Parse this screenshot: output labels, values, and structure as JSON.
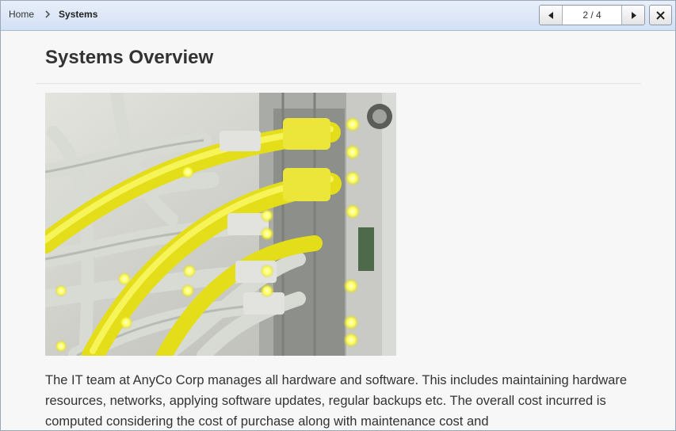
{
  "breadcrumb": {
    "home": "Home",
    "current": "Systems"
  },
  "pager": {
    "position": "2 / 4"
  },
  "page": {
    "title": "Systems Overview",
    "body": "The IT team at AnyCo Corp manages all hardware and software. This includes maintaining hardware resources, networks, applying software updates, regular backups etc. The overall cost incurred is computed considering the cost of purchase along with maintenance cost and"
  },
  "icons": {
    "breadcrumb_separator": "chevron-right-icon",
    "prev": "triangle-left-icon",
    "next": "triangle-right-icon",
    "close": "close-icon"
  },
  "colors": {
    "header_bg": "#d3e0f4",
    "cable_yellow": "#e6e000",
    "led_yellow": "#ffff66"
  }
}
